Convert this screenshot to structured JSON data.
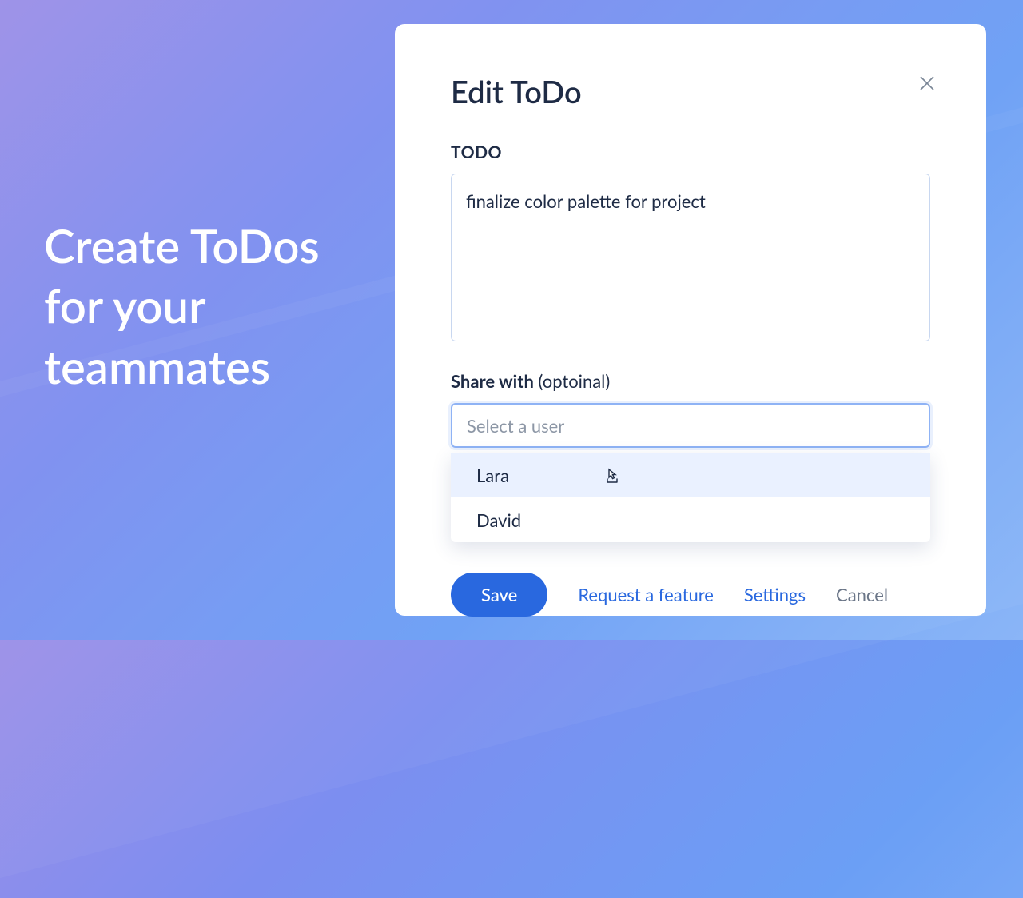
{
  "headline": "Create ToDos for your teammates",
  "modal": {
    "title": "Edit ToDo",
    "close_icon": "close-icon",
    "fields": {
      "todo": {
        "label": "TODO",
        "value": "finalize color palette for project"
      },
      "share": {
        "label_bold": "Share with",
        "label_optional": "(optoinal)",
        "placeholder": "Select a user",
        "options": [
          {
            "label": "Lara",
            "hovered": true
          },
          {
            "label": "David",
            "hovered": false
          }
        ]
      }
    },
    "actions": {
      "save": "Save",
      "request_feature": "Request a feature",
      "settings": "Settings",
      "cancel": "Cancel"
    }
  },
  "colors": {
    "primary": "#2968df",
    "text_dark": "#1e2b45",
    "border_light": "#c8d7f0",
    "border_focus": "#8fb3f5"
  }
}
